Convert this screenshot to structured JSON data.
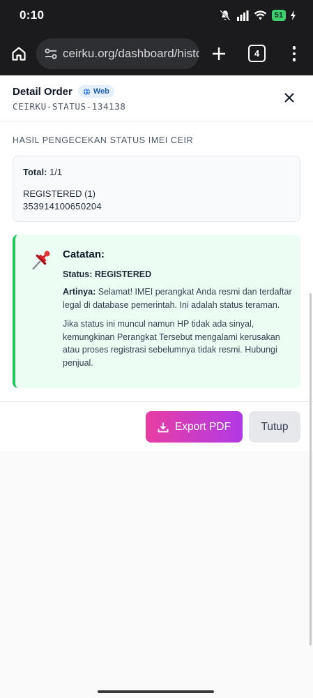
{
  "status_bar": {
    "time": "0:10",
    "battery": "51"
  },
  "browser": {
    "url": "ceirku.org/dashboard/histo",
    "tab_count": "4"
  },
  "modal": {
    "title": "Detail Order",
    "badge": "Web",
    "order_code": "CEIRKU-STATUS-134138",
    "section_title": "HASIL PENGECEKAN STATUS IMEI CEIR",
    "result": {
      "total_label": "Total:",
      "total_value": "1/1",
      "status_line": "REGISTERED (1)",
      "imei": "353914100650204"
    },
    "note": {
      "title": "Catatan:",
      "status_text": "Status: REGISTERED",
      "meaning_label": "Artinya:",
      "meaning_text": "Selamat! IMEI perangkat Anda resmi dan terdaftar legal di database pemerintah. Ini adalah status teraman.",
      "extra_text": "Jika status ini muncul namun HP tidak ada sinyal, kemungkinan Perangkat Tersebut mengalami kerusakan atau proses registrasi sebelumnya tidak resmi. Hubungi penjual."
    },
    "footer": {
      "export_label": "Export PDF",
      "close_label": "Tutup"
    }
  },
  "colors": {
    "accent_gradient_start": "#e83ea3",
    "accent_gradient_end": "#b13ae6",
    "note_border": "#22c55e",
    "note_background": "#ecfdf3",
    "badge_text": "#1d5fb5"
  },
  "icons": {
    "home": "home-icon",
    "site_settings": "tune-icon",
    "new_tab": "plus-icon",
    "menu": "more-vertical-icon",
    "close": "close-icon",
    "globe": "globe-icon",
    "pin": "pushpin-icon",
    "download": "download-icon"
  }
}
